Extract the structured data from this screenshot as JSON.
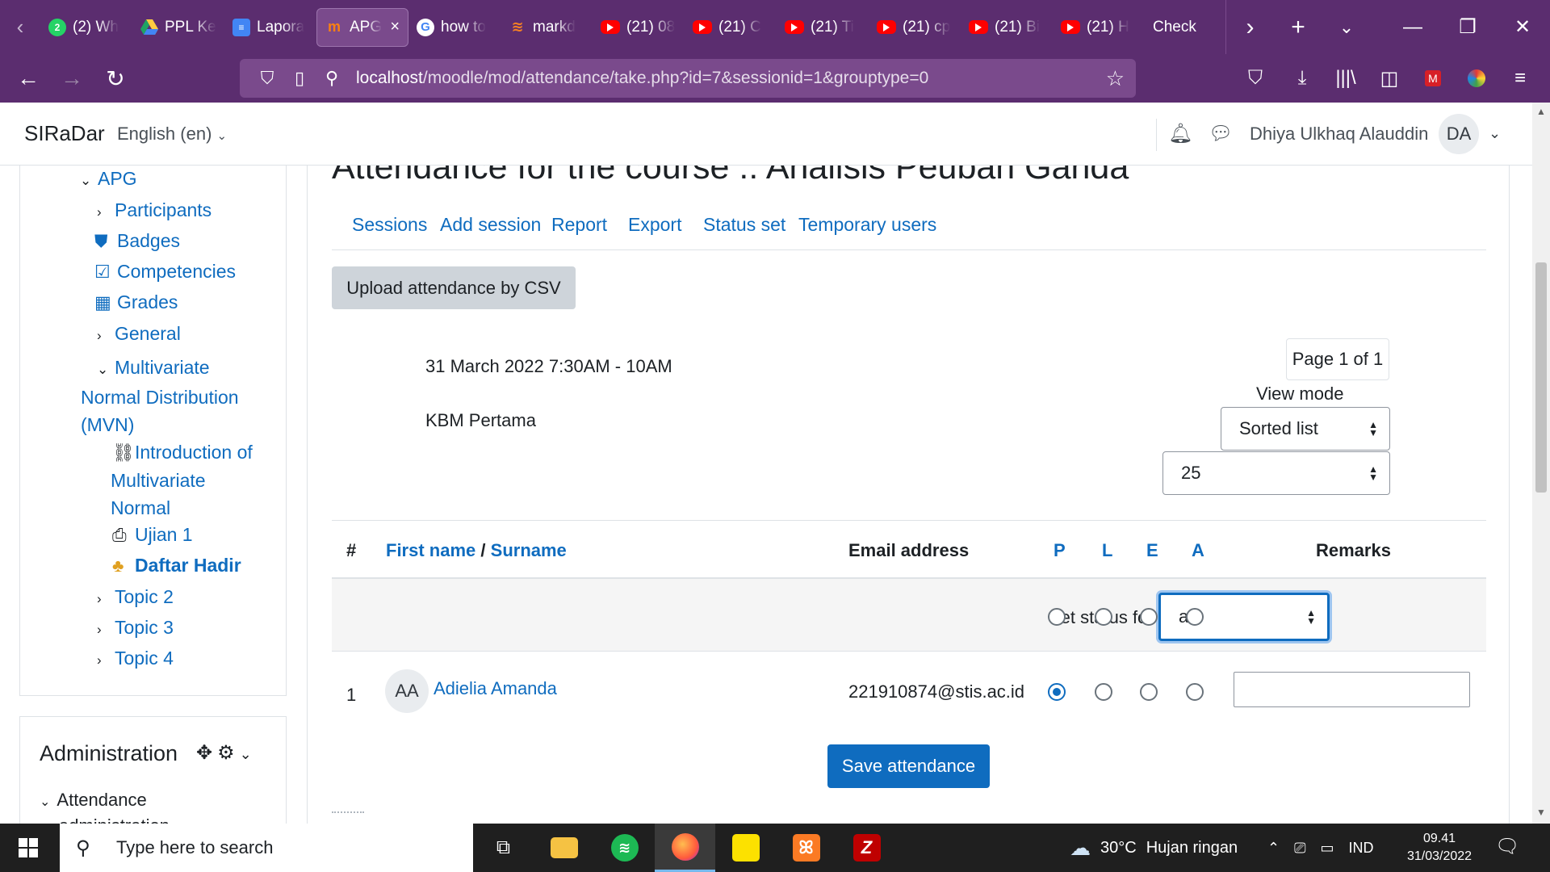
{
  "browser": {
    "tabs": [
      {
        "icon": "whatsapp-icon",
        "title": "(2) Wh",
        "badge": "2"
      },
      {
        "icon": "google-drive-icon",
        "title": "PPL Ke"
      },
      {
        "icon": "google-docs-icon",
        "title": "Lapora"
      },
      {
        "icon": "moodle-icon",
        "title": "APG",
        "active": true
      },
      {
        "icon": "google-icon",
        "title": "how to"
      },
      {
        "icon": "stackoverflow-icon",
        "title": "markd"
      },
      {
        "icon": "youtube-icon",
        "title": "(21) 08"
      },
      {
        "icon": "youtube-icon",
        "title": "(21) C"
      },
      {
        "icon": "youtube-icon",
        "title": "(21) Ti"
      },
      {
        "icon": "youtube-icon",
        "title": "(21) cp"
      },
      {
        "icon": "youtube-icon",
        "title": "(21) Bi"
      },
      {
        "icon": "youtube-icon",
        "title": "(21) H"
      },
      {
        "icon": "none",
        "title": "Check"
      }
    ],
    "url_host": "localhost",
    "url_path": "/moodle/mod/attendance/take.php?id=7&sessionid=1&grouptype=0"
  },
  "header": {
    "site_name": "SIRaDar",
    "language": "English (en)",
    "user_name": "Dhiya Ulkhaq Alauddin",
    "user_initials": "DA"
  },
  "course_nav": {
    "items": [
      {
        "label": "APG",
        "icon": "chevron-down-icon"
      },
      {
        "label": "Participants",
        "icon": "chevron-right-icon"
      },
      {
        "label": "Badges",
        "icon": "shield-icon"
      },
      {
        "label": "Competencies",
        "icon": "check-square-icon"
      },
      {
        "label": "Grades",
        "icon": "table-icon"
      },
      {
        "label": "General",
        "icon": "chevron-right-icon"
      },
      {
        "label": "Multivariate",
        "label2": "Normal Distribution",
        "label3": "(MVN)",
        "icon": "chevron-down-icon"
      },
      {
        "label": "Introduction of",
        "label2": "Multivariate",
        "label3": "Normal",
        "icon": "workflow-icon"
      },
      {
        "label": "Ujian 1",
        "icon": "file-upload-icon"
      },
      {
        "label": "Daftar Hadir",
        "icon": "attendance-icon",
        "current": true
      },
      {
        "label": "Topic 2",
        "icon": "chevron-right-icon"
      },
      {
        "label": "Topic 3",
        "icon": "chevron-right-icon"
      },
      {
        "label": "Topic 4",
        "icon": "chevron-right-icon"
      }
    ]
  },
  "admin": {
    "title": "Administration",
    "item": "Attendance",
    "item_line2": "administration"
  },
  "main": {
    "title": "Attendance for the course :: Analisis Peubah Ganda",
    "tabs": [
      "Sessions",
      "Add session",
      "Report",
      "Export",
      "Status set",
      "Temporary users"
    ],
    "upload_button": "Upload attendance by CSV",
    "session_date": "31 March 2022 7:30AM - 10AM",
    "session_description": "KBM Pertama",
    "page_indicator": "Page 1 of 1",
    "view_mode_label": "View mode",
    "view_mode_value": "Sorted list",
    "per_page_value": "25",
    "table": {
      "col_number": "#",
      "col_first_name": "First name",
      "col_separator": "/",
      "col_surname": "Surname",
      "col_email": "Email address",
      "statuses": [
        "P",
        "L",
        "E",
        "A"
      ],
      "col_remarks": "Remarks",
      "set_status_label": "Set status for",
      "set_status_value": "all",
      "rows": [
        {
          "number": "1",
          "initials": "AA",
          "name": "Adielia Amanda",
          "email": "221910874@stis.ac.id",
          "status": "P",
          "remarks": ""
        }
      ]
    },
    "save_button": "Save attendance"
  },
  "taskbar": {
    "search_placeholder": "Type here to search",
    "apps": [
      "task-view-icon",
      "file-explorer-icon",
      "spotify-icon",
      "firefox-icon",
      "sticky-notes-icon",
      "xampp-icon",
      "filezilla-icon"
    ],
    "weather_temp": "30°C",
    "weather_desc": "Hujan ringan",
    "language": "IND",
    "time": "09.41",
    "date": "31/03/2022"
  },
  "colors": {
    "browser_chrome": "#5b2d6f",
    "link_blue": "#0f6cbf",
    "primary_button": "#0f6cbf",
    "secondary_button": "#ced4da",
    "taskbar": "#1f1f1f"
  }
}
